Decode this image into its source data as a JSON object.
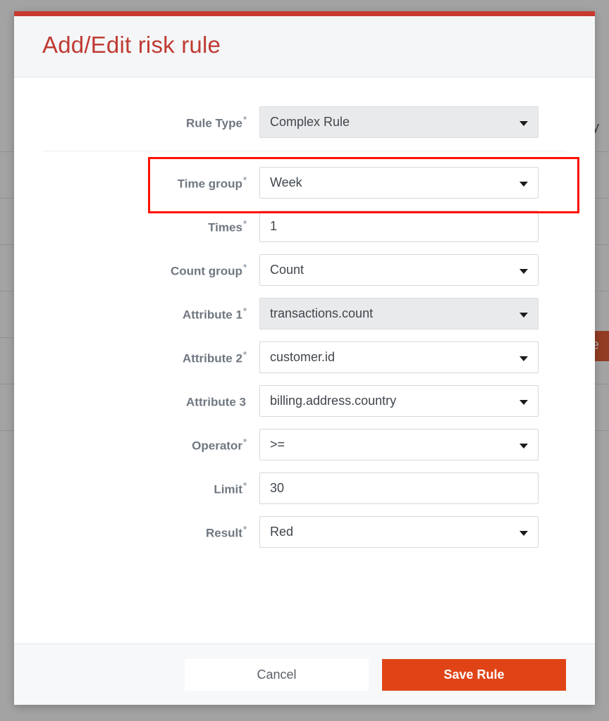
{
  "background": {
    "visible_cell_text": "y",
    "visible_button_text": "ve",
    "row_count": 7
  },
  "modal": {
    "title": "Add/Edit risk rule",
    "accent_color": "#c63a2f",
    "title_color": "#bf3b33",
    "highlight_color": "#ff1100",
    "primary_button_color": "#e04416",
    "rule_type": {
      "label": "Rule Type",
      "required": true,
      "required_marker": "*",
      "value": "Complex Rule",
      "control": "select",
      "disabled": true,
      "caret_icon": "chevron-down-icon"
    },
    "fields": [
      {
        "name": "time-group",
        "label": "Time group",
        "required": true,
        "required_marker": "*",
        "value": "Week",
        "control": "select",
        "disabled": false
      },
      {
        "name": "times",
        "label": "Times",
        "required": true,
        "required_marker": "*",
        "value": "1",
        "control": "text",
        "disabled": false
      },
      {
        "name": "count-group",
        "label": "Count group",
        "required": true,
        "required_marker": "*",
        "value": "Count",
        "control": "select",
        "disabled": false
      },
      {
        "name": "attribute-1",
        "label": "Attribute 1",
        "required": true,
        "required_marker": "*",
        "value": "transactions.count",
        "control": "select",
        "disabled": true
      },
      {
        "name": "attribute-2",
        "label": "Attribute 2",
        "required": true,
        "required_marker": "*",
        "value": "customer.id",
        "control": "select",
        "disabled": false
      },
      {
        "name": "attribute-3",
        "label": "Attribute 3",
        "required": false,
        "required_marker": "",
        "value": "billing.address.country",
        "control": "select",
        "disabled": false
      },
      {
        "name": "operator",
        "label": "Operator",
        "required": true,
        "required_marker": "*",
        "value": ">=",
        "control": "select",
        "disabled": false
      },
      {
        "name": "limit",
        "label": "Limit",
        "required": true,
        "required_marker": "*",
        "value": "30",
        "control": "text",
        "disabled": false
      },
      {
        "name": "result",
        "label": "Result",
        "required": true,
        "required_marker": "*",
        "value": "Red",
        "control": "select",
        "disabled": false
      }
    ],
    "footer": {
      "cancel_label": "Cancel",
      "save_label": "Save Rule"
    }
  }
}
